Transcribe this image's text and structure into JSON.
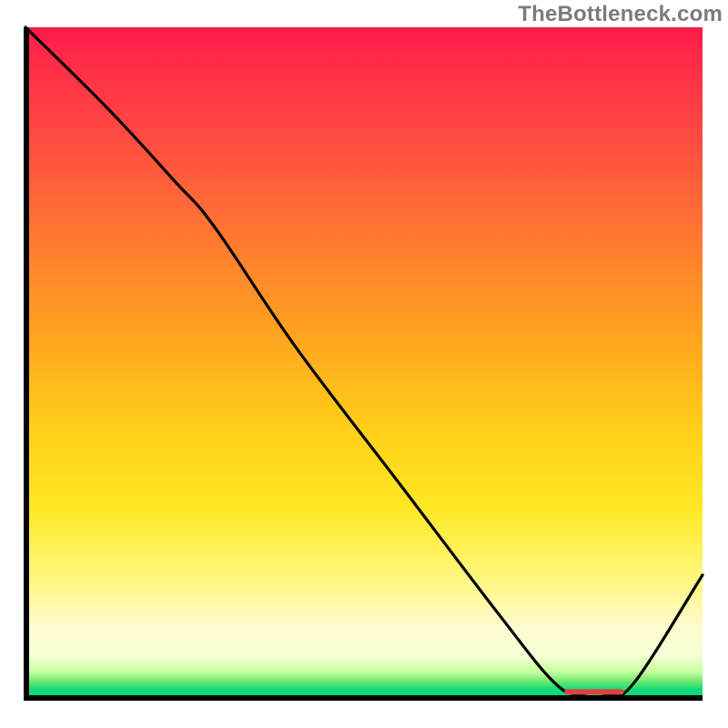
{
  "watermark": "TheBottleneck.com",
  "chart_data": {
    "type": "line",
    "title": "",
    "xlabel": "",
    "ylabel": "",
    "xlim": [
      0,
      100
    ],
    "ylim": [
      0,
      100
    ],
    "grid": false,
    "legend": false,
    "series": [
      {
        "name": "main-curve",
        "color": "#000000",
        "x": [
          0,
          12,
          22,
          28,
          40,
          55,
          70,
          78,
          82,
          86,
          90,
          100
        ],
        "values": [
          100,
          88,
          77,
          70,
          52,
          32,
          12,
          2,
          0,
          0,
          2,
          18
        ]
      }
    ],
    "annotations": [
      {
        "name": "trough-marker",
        "type": "segment",
        "color": "#e04040",
        "x0": 80,
        "y0": 0.5,
        "x1": 88,
        "y1": 0.5
      }
    ],
    "background_gradient": {
      "direction": "vertical",
      "stops": [
        {
          "pos": 0.0,
          "color": "#ff1a4b"
        },
        {
          "pos": 0.32,
          "color": "#ff7a30"
        },
        {
          "pos": 0.6,
          "color": "#ffcf18"
        },
        {
          "pos": 0.9,
          "color": "#fffbd0"
        },
        {
          "pos": 1.0,
          "color": "#08d679"
        }
      ]
    }
  }
}
